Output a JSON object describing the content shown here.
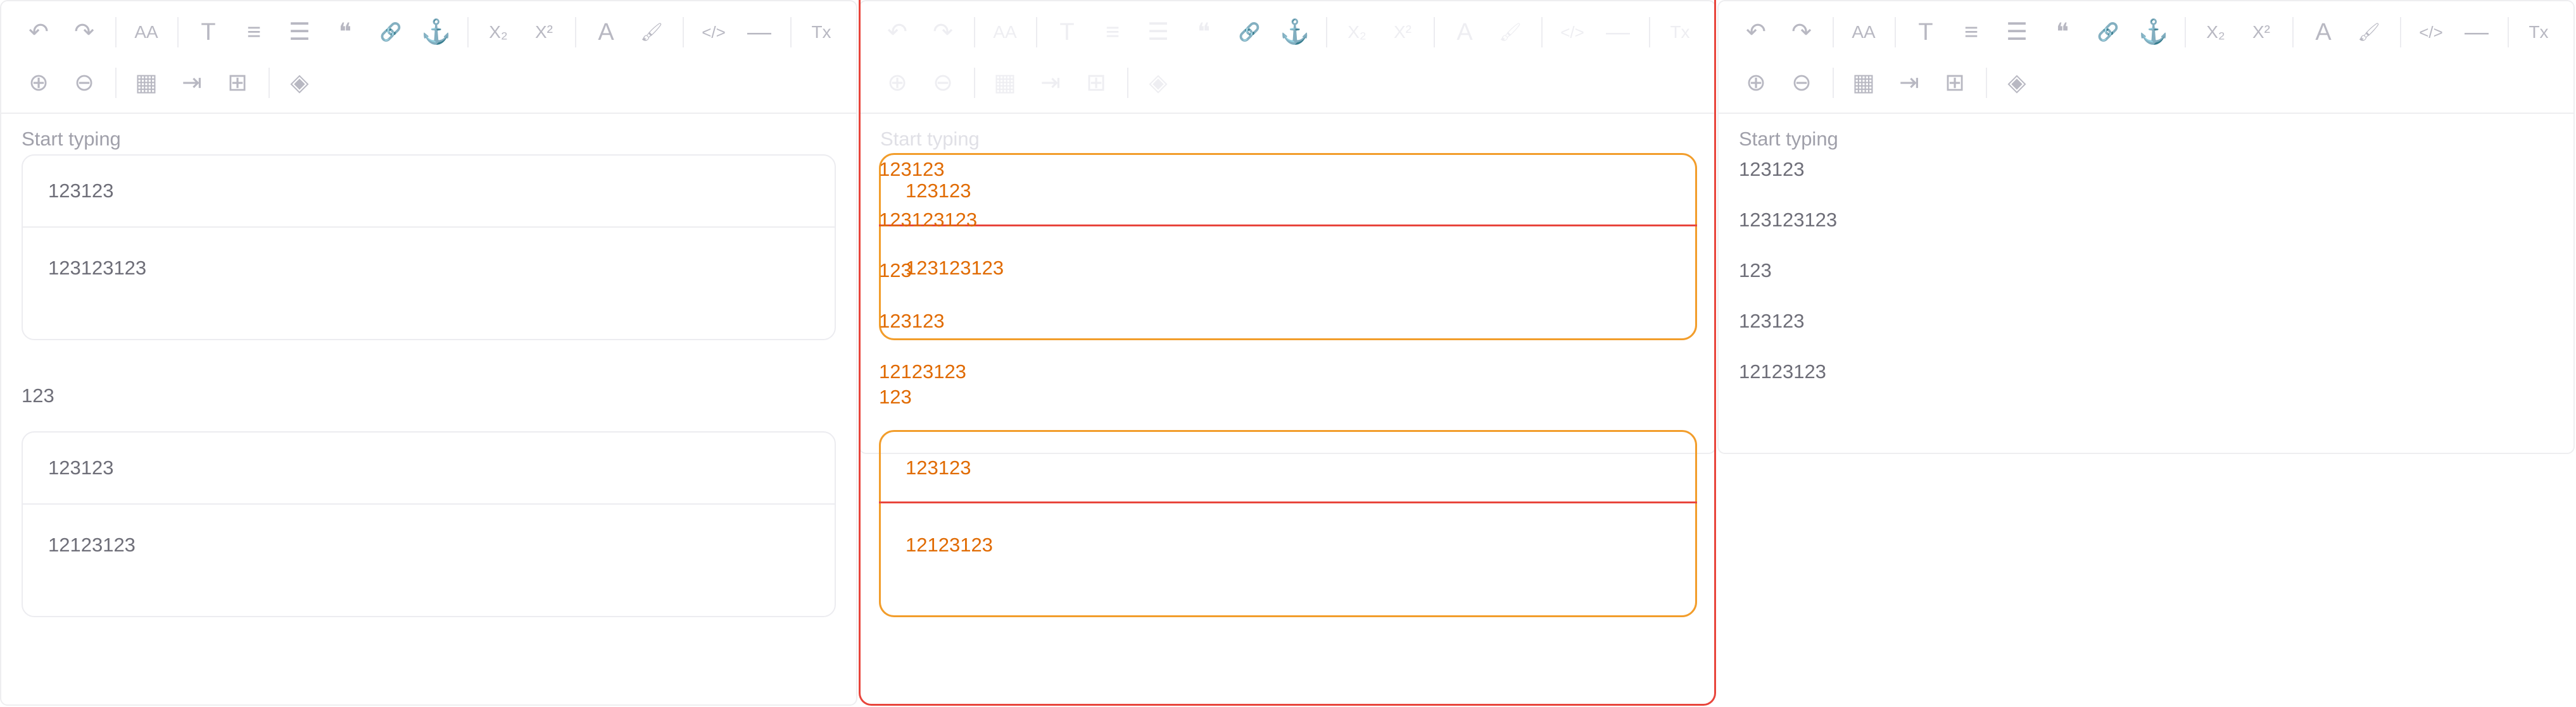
{
  "toolbar": {
    "row1": [
      {
        "icon": "undo-icon",
        "glyph": "↶"
      },
      {
        "icon": "redo-icon",
        "glyph": "↷"
      },
      {
        "sep": true
      },
      {
        "icon": "font-size-icon",
        "glyph": "AA"
      },
      {
        "sep": true
      },
      {
        "icon": "text-style-icon",
        "glyph": "T"
      },
      {
        "icon": "align-icon",
        "glyph": "≡"
      },
      {
        "icon": "list-icon",
        "glyph": "☰"
      },
      {
        "icon": "quote-icon",
        "glyph": "❝"
      },
      {
        "icon": "link-icon",
        "glyph": "🔗"
      },
      {
        "icon": "anchor-icon",
        "glyph": "⚓"
      },
      {
        "sep": true
      },
      {
        "icon": "subscript-icon",
        "glyph": "X₂"
      },
      {
        "icon": "superscript-icon",
        "glyph": "X²"
      },
      {
        "sep": true
      },
      {
        "icon": "font-color-icon",
        "glyph": "A"
      },
      {
        "icon": "format-painter-icon",
        "glyph": "🖌"
      },
      {
        "sep": true
      },
      {
        "icon": "code-icon",
        "glyph": "</>"
      },
      {
        "icon": "horizontal-rule-icon",
        "glyph": "—"
      },
      {
        "sep": true
      },
      {
        "icon": "clear-format-icon",
        "glyph": "Tx"
      }
    ],
    "row2": [
      {
        "icon": "add-row-icon",
        "glyph": "⊕"
      },
      {
        "icon": "delete-icon",
        "glyph": "⊖"
      },
      {
        "sep": true
      },
      {
        "icon": "table-icon",
        "glyph": "▦"
      },
      {
        "icon": "insert-column-icon",
        "glyph": "⇥"
      },
      {
        "icon": "delete-column-icon",
        "glyph": "⊞"
      },
      {
        "sep": true
      },
      {
        "icon": "fill-color-icon",
        "glyph": "◈"
      }
    ]
  },
  "placeholder": "Start typing",
  "left_panel": {
    "table1": [
      "123123",
      "123123123"
    ],
    "paragraph": "123",
    "table2": [
      "123123",
      "12123123"
    ]
  },
  "debug_panel": {
    "texts": [
      "123123",
      "123123",
      "123123123",
      "123",
      "123123123",
      "123123",
      "12123123",
      "123",
      "123123",
      "12123123"
    ]
  },
  "right_panel": {
    "paragraphs": [
      "123123",
      "123123123",
      "123",
      "123123",
      "12123123"
    ]
  }
}
